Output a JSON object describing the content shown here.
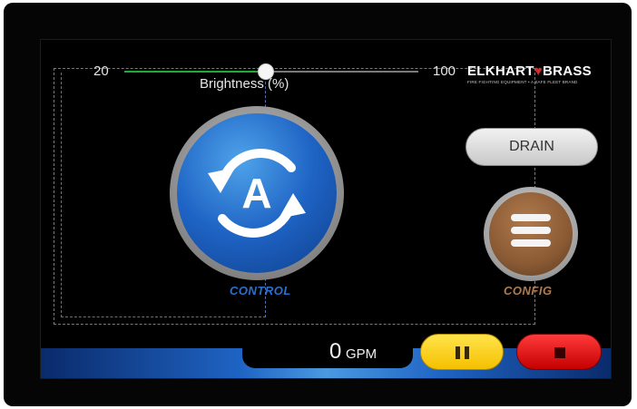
{
  "brightness": {
    "min_label": "20",
    "max_label": "100",
    "label": "Brightness (%)",
    "value_percent": 48
  },
  "brand": {
    "name_left": "ELKHART",
    "name_right": "BRASS",
    "tagline": "FIRE FIGHTING EQUIPMENT • A SAFE FLEET BRAND",
    "icon": "heart-icon",
    "accent": "#d42a2a"
  },
  "control": {
    "label": "CONTROL",
    "icon": "auto-cycle-icon",
    "icon_letter": "A",
    "color": "#1e63c4"
  },
  "drain": {
    "label": "DRAIN"
  },
  "config": {
    "label": "CONFIG",
    "icon": "menu-icon",
    "color": "#8a5a34"
  },
  "flow": {
    "value": "0",
    "unit": "GPM"
  },
  "transport": {
    "pause_icon": "pause-icon",
    "pause_color": "#f5c000",
    "stop_icon": "stop-icon",
    "stop_color": "#c40000"
  }
}
